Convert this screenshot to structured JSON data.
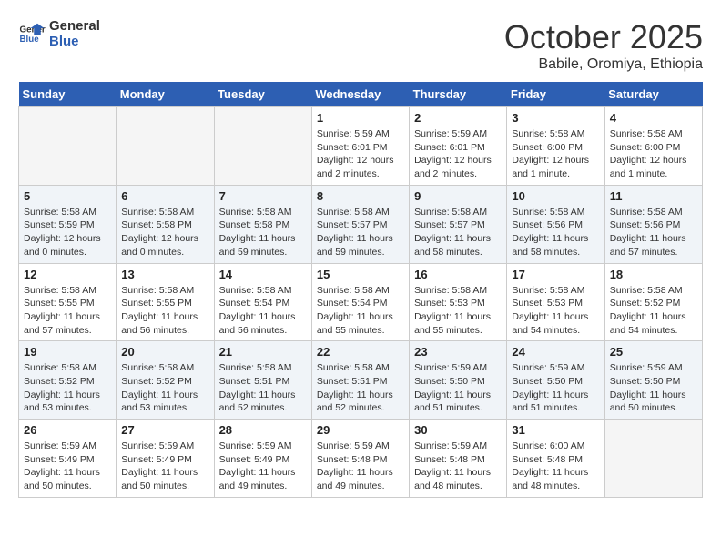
{
  "header": {
    "logo_line1": "General",
    "logo_line2": "Blue",
    "month": "October 2025",
    "location": "Babile, Oromiya, Ethiopia"
  },
  "weekdays": [
    "Sunday",
    "Monday",
    "Tuesday",
    "Wednesday",
    "Thursday",
    "Friday",
    "Saturday"
  ],
  "weeks": [
    [
      {
        "day": "",
        "info": ""
      },
      {
        "day": "",
        "info": ""
      },
      {
        "day": "",
        "info": ""
      },
      {
        "day": "1",
        "info": "Sunrise: 5:59 AM\nSunset: 6:01 PM\nDaylight: 12 hours\nand 2 minutes."
      },
      {
        "day": "2",
        "info": "Sunrise: 5:59 AM\nSunset: 6:01 PM\nDaylight: 12 hours\nand 2 minutes."
      },
      {
        "day": "3",
        "info": "Sunrise: 5:58 AM\nSunset: 6:00 PM\nDaylight: 12 hours\nand 1 minute."
      },
      {
        "day": "4",
        "info": "Sunrise: 5:58 AM\nSunset: 6:00 PM\nDaylight: 12 hours\nand 1 minute."
      }
    ],
    [
      {
        "day": "5",
        "info": "Sunrise: 5:58 AM\nSunset: 5:59 PM\nDaylight: 12 hours\nand 0 minutes."
      },
      {
        "day": "6",
        "info": "Sunrise: 5:58 AM\nSunset: 5:58 PM\nDaylight: 12 hours\nand 0 minutes."
      },
      {
        "day": "7",
        "info": "Sunrise: 5:58 AM\nSunset: 5:58 PM\nDaylight: 11 hours\nand 59 minutes."
      },
      {
        "day": "8",
        "info": "Sunrise: 5:58 AM\nSunset: 5:57 PM\nDaylight: 11 hours\nand 59 minutes."
      },
      {
        "day": "9",
        "info": "Sunrise: 5:58 AM\nSunset: 5:57 PM\nDaylight: 11 hours\nand 58 minutes."
      },
      {
        "day": "10",
        "info": "Sunrise: 5:58 AM\nSunset: 5:56 PM\nDaylight: 11 hours\nand 58 minutes."
      },
      {
        "day": "11",
        "info": "Sunrise: 5:58 AM\nSunset: 5:56 PM\nDaylight: 11 hours\nand 57 minutes."
      }
    ],
    [
      {
        "day": "12",
        "info": "Sunrise: 5:58 AM\nSunset: 5:55 PM\nDaylight: 11 hours\nand 57 minutes."
      },
      {
        "day": "13",
        "info": "Sunrise: 5:58 AM\nSunset: 5:55 PM\nDaylight: 11 hours\nand 56 minutes."
      },
      {
        "day": "14",
        "info": "Sunrise: 5:58 AM\nSunset: 5:54 PM\nDaylight: 11 hours\nand 56 minutes."
      },
      {
        "day": "15",
        "info": "Sunrise: 5:58 AM\nSunset: 5:54 PM\nDaylight: 11 hours\nand 55 minutes."
      },
      {
        "day": "16",
        "info": "Sunrise: 5:58 AM\nSunset: 5:53 PM\nDaylight: 11 hours\nand 55 minutes."
      },
      {
        "day": "17",
        "info": "Sunrise: 5:58 AM\nSunset: 5:53 PM\nDaylight: 11 hours\nand 54 minutes."
      },
      {
        "day": "18",
        "info": "Sunrise: 5:58 AM\nSunset: 5:52 PM\nDaylight: 11 hours\nand 54 minutes."
      }
    ],
    [
      {
        "day": "19",
        "info": "Sunrise: 5:58 AM\nSunset: 5:52 PM\nDaylight: 11 hours\nand 53 minutes."
      },
      {
        "day": "20",
        "info": "Sunrise: 5:58 AM\nSunset: 5:52 PM\nDaylight: 11 hours\nand 53 minutes."
      },
      {
        "day": "21",
        "info": "Sunrise: 5:58 AM\nSunset: 5:51 PM\nDaylight: 11 hours\nand 52 minutes."
      },
      {
        "day": "22",
        "info": "Sunrise: 5:58 AM\nSunset: 5:51 PM\nDaylight: 11 hours\nand 52 minutes."
      },
      {
        "day": "23",
        "info": "Sunrise: 5:59 AM\nSunset: 5:50 PM\nDaylight: 11 hours\nand 51 minutes."
      },
      {
        "day": "24",
        "info": "Sunrise: 5:59 AM\nSunset: 5:50 PM\nDaylight: 11 hours\nand 51 minutes."
      },
      {
        "day": "25",
        "info": "Sunrise: 5:59 AM\nSunset: 5:50 PM\nDaylight: 11 hours\nand 50 minutes."
      }
    ],
    [
      {
        "day": "26",
        "info": "Sunrise: 5:59 AM\nSunset: 5:49 PM\nDaylight: 11 hours\nand 50 minutes."
      },
      {
        "day": "27",
        "info": "Sunrise: 5:59 AM\nSunset: 5:49 PM\nDaylight: 11 hours\nand 50 minutes."
      },
      {
        "day": "28",
        "info": "Sunrise: 5:59 AM\nSunset: 5:49 PM\nDaylight: 11 hours\nand 49 minutes."
      },
      {
        "day": "29",
        "info": "Sunrise: 5:59 AM\nSunset: 5:48 PM\nDaylight: 11 hours\nand 49 minutes."
      },
      {
        "day": "30",
        "info": "Sunrise: 5:59 AM\nSunset: 5:48 PM\nDaylight: 11 hours\nand 48 minutes."
      },
      {
        "day": "31",
        "info": "Sunrise: 6:00 AM\nSunset: 5:48 PM\nDaylight: 11 hours\nand 48 minutes."
      },
      {
        "day": "",
        "info": ""
      }
    ]
  ]
}
